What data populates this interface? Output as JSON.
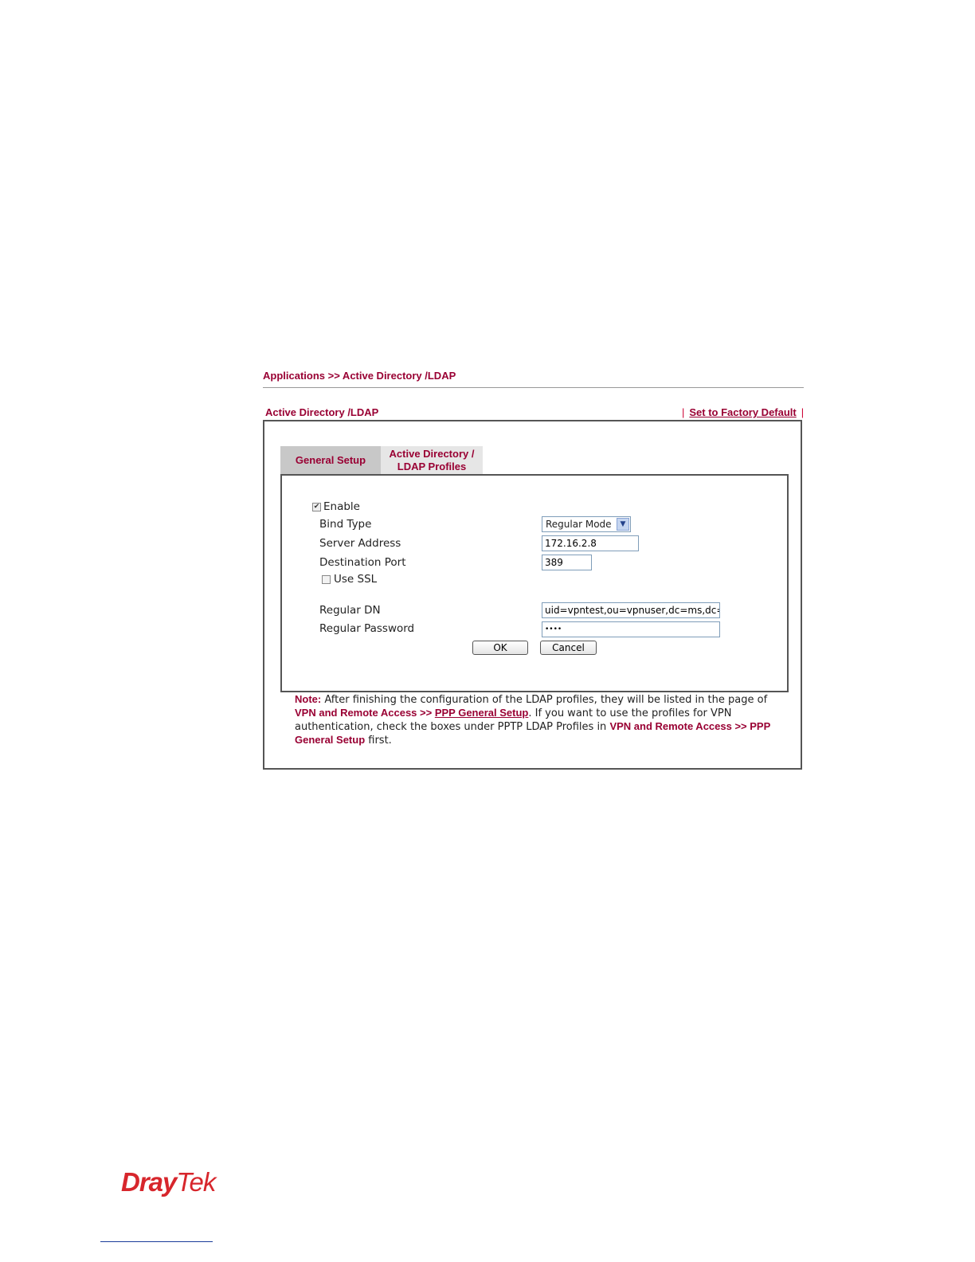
{
  "breadcrumb": "Applications >> Active Directory /LDAP",
  "section": {
    "title": "Active Directory /LDAP",
    "factory_default_label": "Set to Factory Default",
    "separator": "|"
  },
  "tabs": [
    {
      "label_line1": "General Setup",
      "label_line2": ""
    },
    {
      "label_line1": "Active Directory /",
      "label_line2": "LDAP Profiles"
    }
  ],
  "form": {
    "enable": {
      "label": "Enable",
      "checked": true
    },
    "bind_type": {
      "label": "Bind Type",
      "value": "Regular Mode"
    },
    "server_address": {
      "label": "Server Address",
      "value": "172.16.2.8"
    },
    "destination_port": {
      "label": "Destination Port",
      "value": "389"
    },
    "use_ssl": {
      "label": "Use SSL",
      "checked": false
    },
    "regular_dn": {
      "label": "Regular DN",
      "value": "uid=vpntest,ou=vpnuser,dc=ms,dc=dr"
    },
    "regular_password": {
      "label": "Regular Password",
      "value": "••••"
    },
    "ok_label": "OK",
    "cancel_label": "Cancel"
  },
  "note": {
    "prefix": "Note:",
    "text1": " After finishing the configuration of the LDAP profiles, they will be listed in the page of ",
    "link1": "VPN and Remote Access >> ",
    "link1b": "PPP General Setup",
    "text2": ". If you want to use the profiles for VPN authentication, check the boxes under PPTP LDAP Profiles in ",
    "link2": "VPN and Remote Access >> PPP General Setup",
    "text3": " first."
  },
  "footer": {
    "logo_dray": "Dray",
    "logo_tek": "Tek"
  },
  "colors": {
    "accent": "#990033",
    "logo": "#d7262c"
  }
}
